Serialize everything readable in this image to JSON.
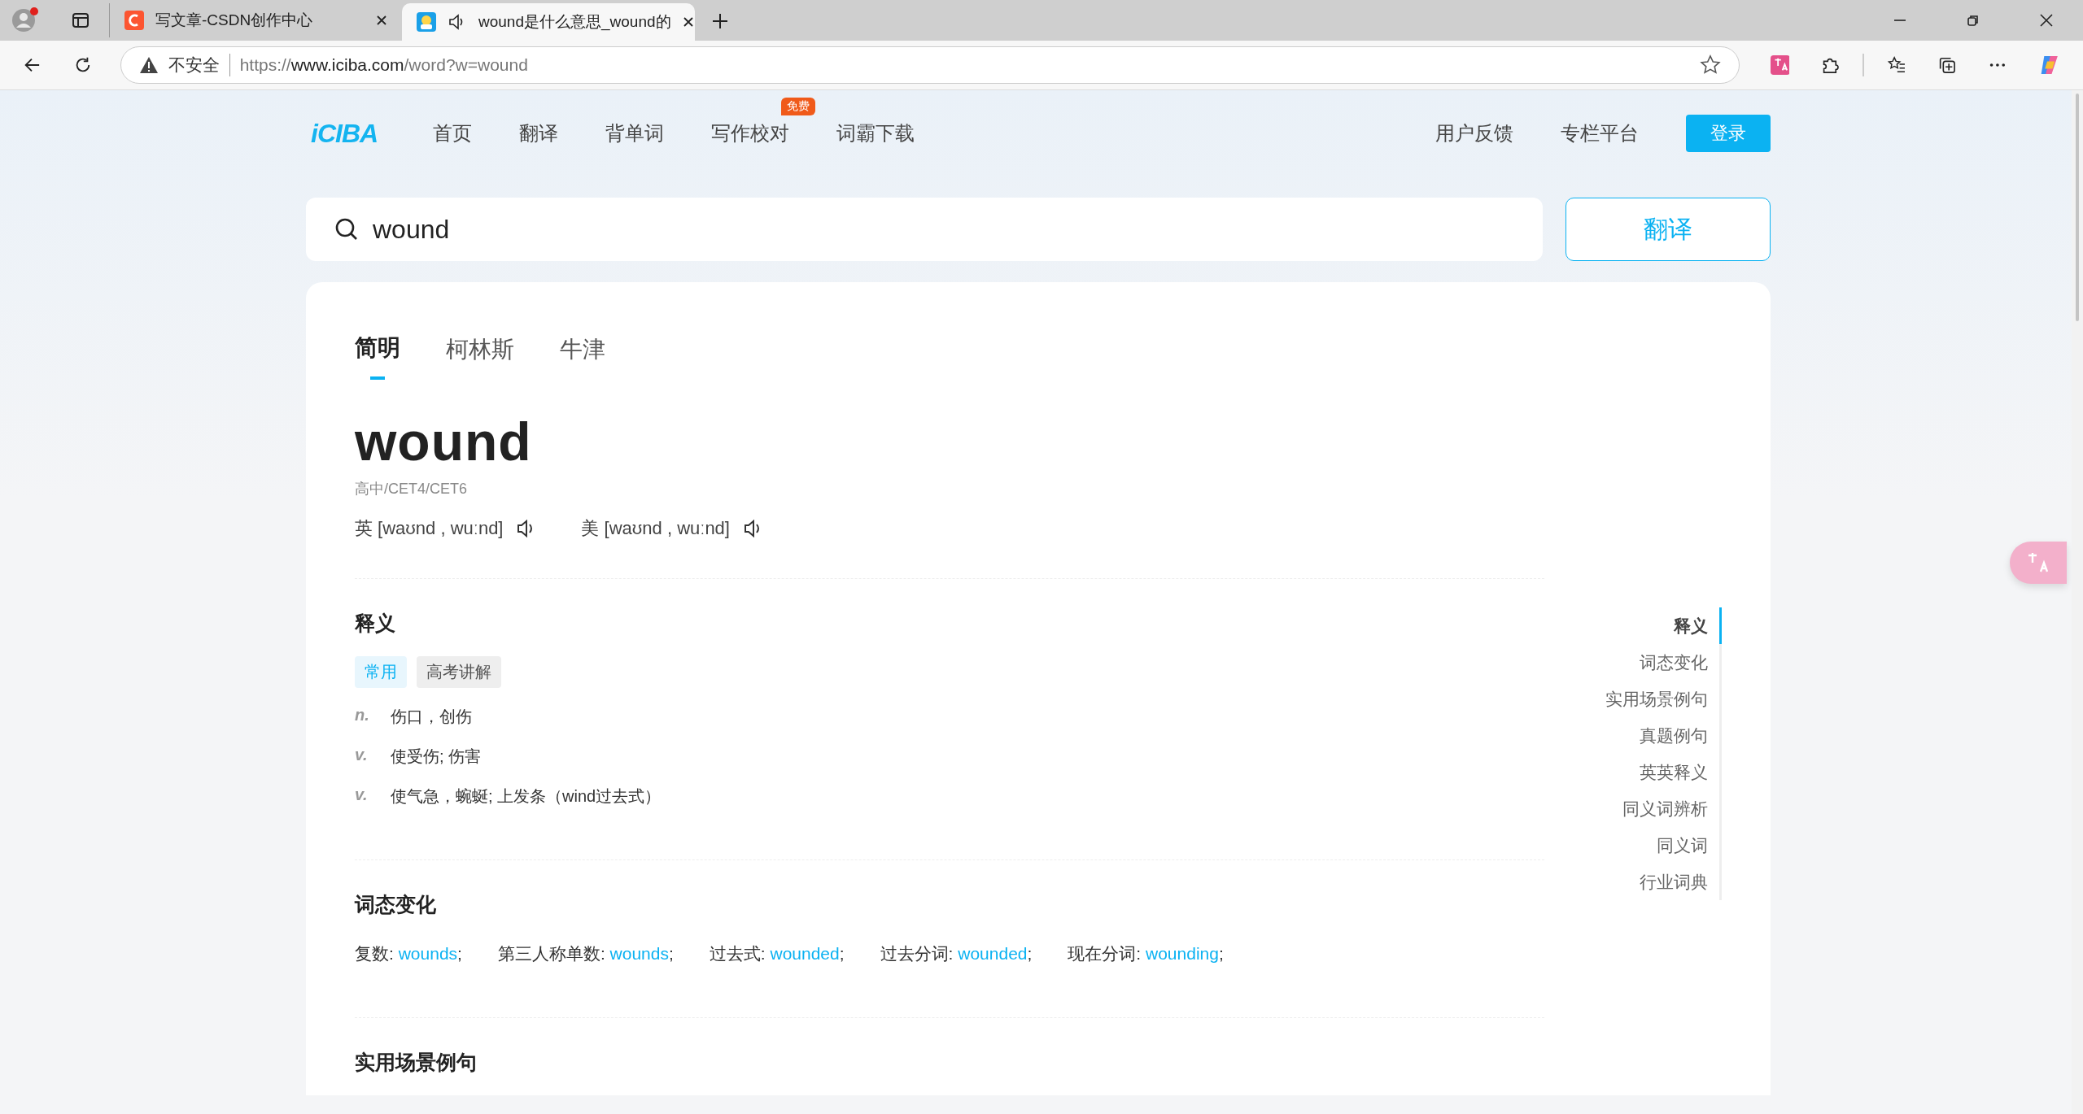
{
  "browser": {
    "tabs": [
      {
        "title": "写文章-CSDN创作中心",
        "selected": false,
        "audio": false,
        "kind": "csdn"
      },
      {
        "title": "wound是什么意思_wound的",
        "selected": true,
        "audio": true,
        "kind": "iciba"
      }
    ],
    "address": {
      "security": "不安全",
      "scheme": "https://",
      "host": "www.iciba.com",
      "path": "/word?w=wound"
    }
  },
  "site_nav": {
    "logo": "iCIBA",
    "items": [
      {
        "label": "首页"
      },
      {
        "label": "翻译"
      },
      {
        "label": "背单词"
      },
      {
        "label": "写作校对",
        "badge": "免费"
      },
      {
        "label": "词霸下载"
      }
    ],
    "right_links": [
      "用户反馈",
      "专栏平台"
    ],
    "login": "登录"
  },
  "search": {
    "value": "wound",
    "button": "翻译"
  },
  "dict_tabs": [
    {
      "label": "简明",
      "selected": true
    },
    {
      "label": "柯林斯",
      "selected": false
    },
    {
      "label": "牛津",
      "selected": false
    }
  ],
  "word": "wound",
  "levels": "高中/CET4/CET6",
  "pronunciations": [
    {
      "region": "英",
      "ipa": "[waʊnd , wuːnd]"
    },
    {
      "region": "美",
      "ipa": "[waʊnd , wuːnd]"
    }
  ],
  "definitions": {
    "title": "释义",
    "tags": [
      {
        "label": "常用",
        "selected": true
      },
      {
        "label": "高考讲解",
        "selected": false
      }
    ],
    "meanings": [
      {
        "pos": "n.",
        "text": "伤口，创伤"
      },
      {
        "pos": "v.",
        "text": "使受伤; 伤害"
      },
      {
        "pos": "v.",
        "text": "使气急，蜿蜒; 上发条（wind过去式）"
      }
    ]
  },
  "forms": {
    "title": "词态变化",
    "items": [
      {
        "label": "复数: ",
        "value": "wounds",
        "end": ";"
      },
      {
        "label": "第三人称单数: ",
        "value": "wounds",
        "end": ";"
      },
      {
        "label": "过去式: ",
        "value": "wounded",
        "end": ";"
      },
      {
        "label": "过去分词: ",
        "value": "wounded",
        "end": ";"
      },
      {
        "label": "现在分词: ",
        "value": "wounding",
        "end": ";"
      }
    ]
  },
  "next_section": {
    "title": "实用场景例句"
  },
  "side_nav": [
    {
      "label": "释义",
      "selected": true
    },
    {
      "label": "词态变化",
      "selected": false
    },
    {
      "label": "实用场景例句",
      "selected": false
    },
    {
      "label": "真题例句",
      "selected": false
    },
    {
      "label": "英英释义",
      "selected": false
    },
    {
      "label": "同义词辨析",
      "selected": false
    },
    {
      "label": "同义词",
      "selected": false
    },
    {
      "label": "行业词典",
      "selected": false
    }
  ]
}
